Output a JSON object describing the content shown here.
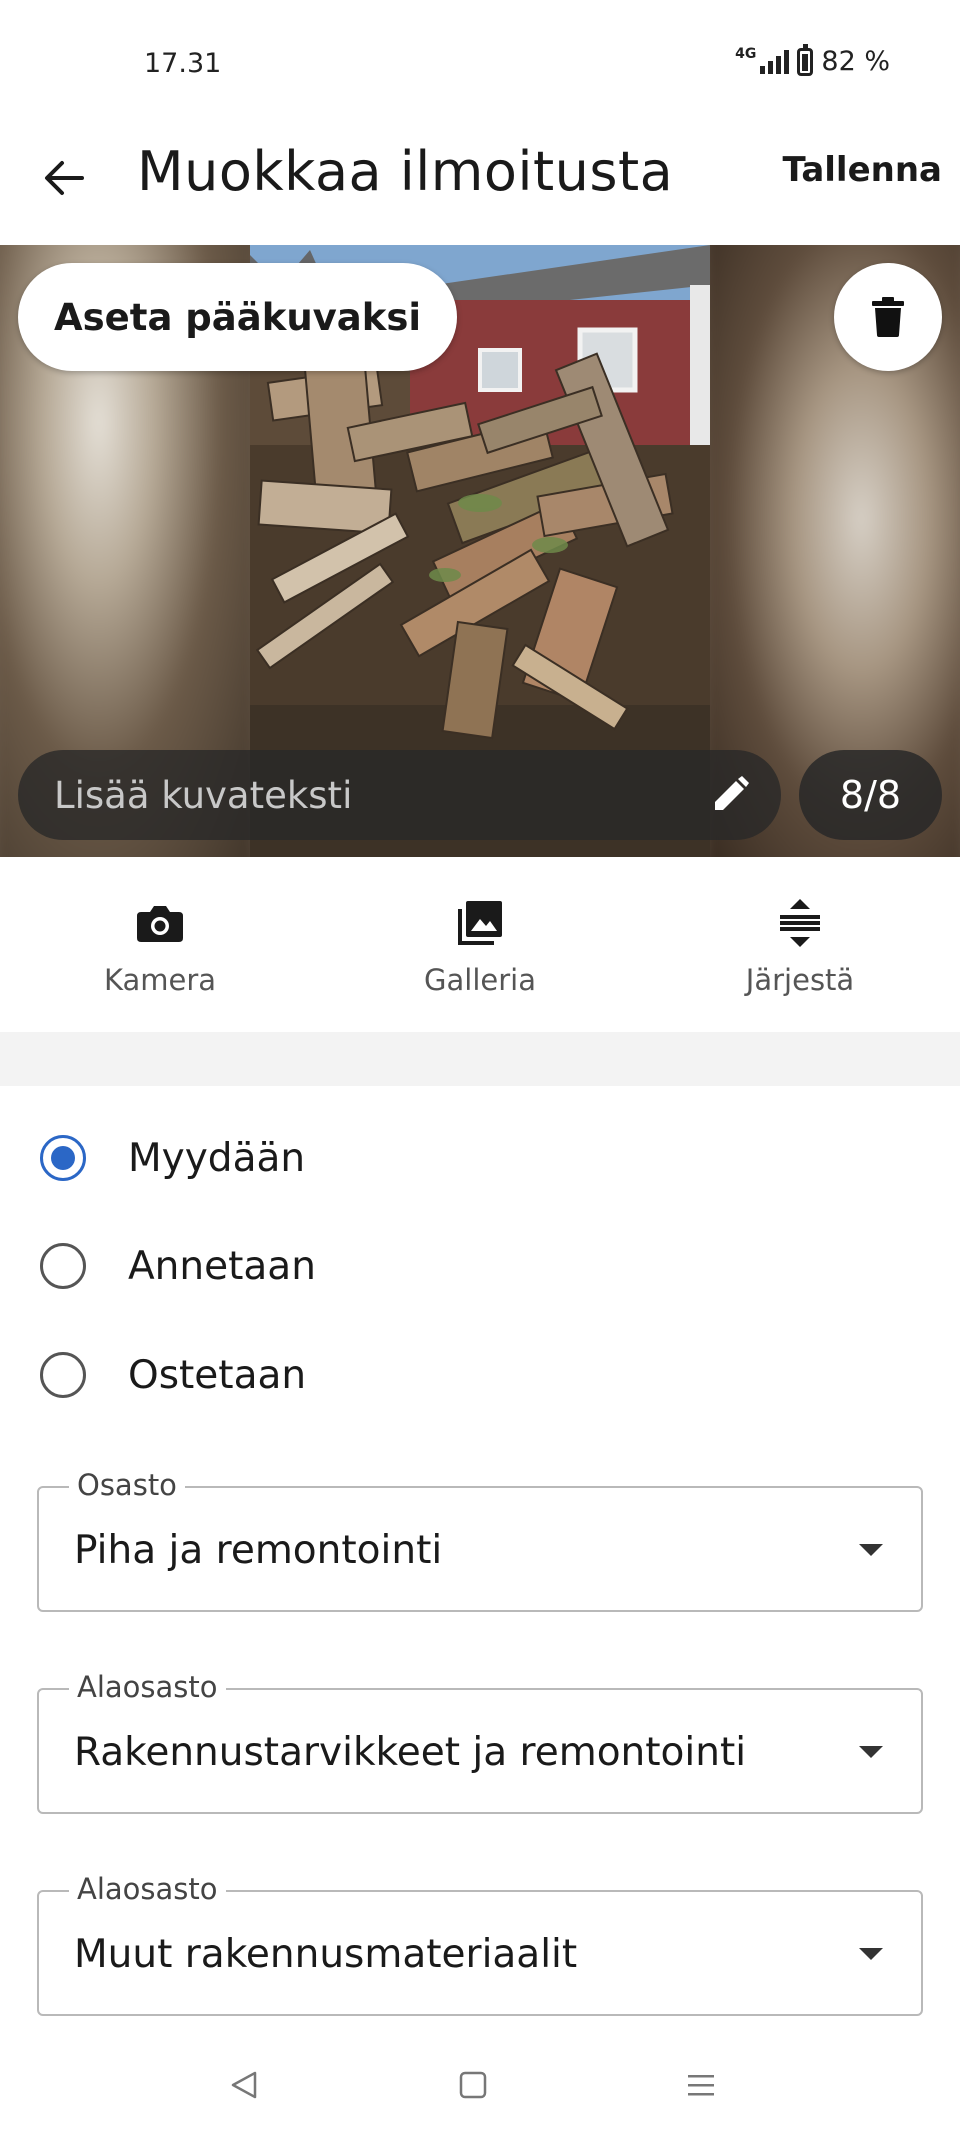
{
  "status_bar": {
    "time": "17.31",
    "network": "4G",
    "battery": "82 %"
  },
  "app_bar": {
    "back_icon": "arrow-left-icon",
    "title": "Muokkaa ilmoitusta",
    "save_label": "Tallenna"
  },
  "carousel": {
    "set_main_label": "Aseta pääkuvaksi",
    "delete_icon": "trash-icon",
    "caption_placeholder": "Lisää kuvateksti",
    "caption_edit_icon": "pencil-icon",
    "counter": "8/8"
  },
  "photo_actions": [
    {
      "label": "Kamera",
      "icon": "camera-icon"
    },
    {
      "label": "Galleria",
      "icon": "gallery-icon"
    },
    {
      "label": "Järjestä",
      "icon": "reorder-icon"
    }
  ],
  "listing_type": {
    "selected": "Myydään",
    "options": [
      "Myydään",
      "Annetaan",
      "Ostetaan"
    ]
  },
  "fields": [
    {
      "label": "Osasto",
      "value": "Piha ja remontointi"
    },
    {
      "label": "Alaosasto",
      "value": "Rakennustarvikkeet ja remontointi"
    },
    {
      "label": "Alaosasto",
      "value": "Muut rakennusmateriaalit"
    }
  ],
  "colors": {
    "accent": "#2b67c6",
    "text": "#1a1a1a",
    "divider": "#f3f3f3"
  },
  "nav_bar": {
    "back_icon": "triangle-back-icon",
    "home_icon": "square-home-icon",
    "menu_icon": "menu-lines-icon"
  }
}
